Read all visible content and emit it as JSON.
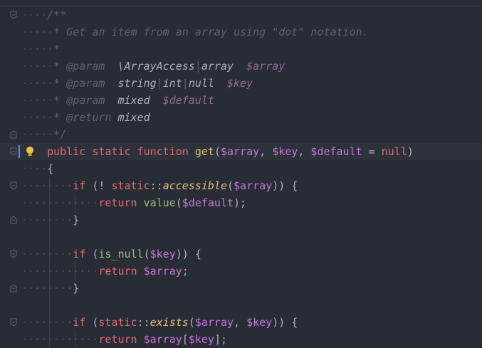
{
  "editor": {
    "lines": [
      {
        "indent": "····",
        "parts": [
          {
            "t": "/**",
            "c": "doc"
          }
        ]
      },
      {
        "indent": "·····",
        "parts": [
          {
            "t": "* Get an item from an array using \"dot\" notation.",
            "c": "doc"
          }
        ]
      },
      {
        "indent": "·····",
        "parts": [
          {
            "t": "*",
            "c": "doc"
          }
        ]
      },
      {
        "indent": "·····",
        "parts": [
          {
            "t": "* ",
            "c": "doc"
          },
          {
            "t": "@param",
            "c": "tag"
          },
          {
            "t": "  ",
            "c": "doc"
          },
          {
            "t": "\\ArrayAccess",
            "c": "type"
          },
          {
            "t": "|",
            "c": "doc"
          },
          {
            "t": "array",
            "c": "type"
          },
          {
            "t": "  ",
            "c": "doc"
          },
          {
            "t": "$array",
            "c": "dvar"
          }
        ]
      },
      {
        "indent": "·····",
        "parts": [
          {
            "t": "* ",
            "c": "doc"
          },
          {
            "t": "@param",
            "c": "tag"
          },
          {
            "t": "  ",
            "c": "doc"
          },
          {
            "t": "string",
            "c": "type"
          },
          {
            "t": "|",
            "c": "doc"
          },
          {
            "t": "int",
            "c": "type"
          },
          {
            "t": "|",
            "c": "doc"
          },
          {
            "t": "null",
            "c": "type"
          },
          {
            "t": "  ",
            "c": "doc"
          },
          {
            "t": "$key",
            "c": "dvar"
          }
        ]
      },
      {
        "indent": "·····",
        "parts": [
          {
            "t": "* ",
            "c": "doc"
          },
          {
            "t": "@param",
            "c": "tag"
          },
          {
            "t": "  ",
            "c": "doc"
          },
          {
            "t": "mixed",
            "c": "type"
          },
          {
            "t": "  ",
            "c": "doc"
          },
          {
            "t": "$default",
            "c": "dvar"
          }
        ]
      },
      {
        "indent": "·····",
        "parts": [
          {
            "t": "* ",
            "c": "doc"
          },
          {
            "t": "@return",
            "c": "tag"
          },
          {
            "t": " ",
            "c": "doc"
          },
          {
            "t": "mixed",
            "c": "type"
          }
        ]
      },
      {
        "indent": "·····",
        "parts": [
          {
            "t": "*/",
            "c": "doc"
          }
        ]
      },
      {
        "indent": "    ",
        "parts": [
          {
            "t": "public",
            "c": "kw"
          },
          {
            "t": " ",
            "c": "pun"
          },
          {
            "t": "static",
            "c": "kw"
          },
          {
            "t": " ",
            "c": "pun"
          },
          {
            "t": "function",
            "c": "kw"
          },
          {
            "t": " ",
            "c": "pun"
          },
          {
            "t": "get",
            "c": "fn"
          },
          {
            "t": "(",
            "c": "pun"
          },
          {
            "t": "$array",
            "c": "var"
          },
          {
            "t": ", ",
            "c": "pun"
          },
          {
            "t": "$key",
            "c": "var"
          },
          {
            "t": ", ",
            "c": "pun"
          },
          {
            "t": "$default",
            "c": "var"
          },
          {
            "t": " = ",
            "c": "pun"
          },
          {
            "t": "null",
            "c": "lit"
          },
          {
            "t": ")",
            "c": "pun"
          }
        ]
      },
      {
        "indent": "····",
        "parts": [
          {
            "t": "{",
            "c": "pun"
          }
        ]
      },
      {
        "indent": "········",
        "parts": [
          {
            "t": "if",
            "c": "kw"
          },
          {
            "t": " (! ",
            "c": "pun"
          },
          {
            "t": "static",
            "c": "kw"
          },
          {
            "t": "::",
            "c": "pun"
          },
          {
            "t": "accessible",
            "c": "fn-i"
          },
          {
            "t": "(",
            "c": "pun"
          },
          {
            "t": "$array",
            "c": "var"
          },
          {
            "t": ")) {",
            "c": "pun"
          }
        ]
      },
      {
        "indent": "············",
        "parts": [
          {
            "t": "return",
            "c": "kw"
          },
          {
            "t": " ",
            "c": "pun"
          },
          {
            "t": "value",
            "c": "call"
          },
          {
            "t": "(",
            "c": "pun"
          },
          {
            "t": "$default",
            "c": "var"
          },
          {
            "t": ");",
            "c": "pun"
          }
        ]
      },
      {
        "indent": "········",
        "parts": [
          {
            "t": "}",
            "c": "pun"
          }
        ]
      },
      {
        "indent": "",
        "parts": []
      },
      {
        "indent": "········",
        "parts": [
          {
            "t": "if",
            "c": "kw"
          },
          {
            "t": " (",
            "c": "pun"
          },
          {
            "t": "is_null",
            "c": "call"
          },
          {
            "t": "(",
            "c": "pun"
          },
          {
            "t": "$key",
            "c": "var"
          },
          {
            "t": ")) {",
            "c": "pun"
          }
        ]
      },
      {
        "indent": "············",
        "parts": [
          {
            "t": "return",
            "c": "kw"
          },
          {
            "t": " ",
            "c": "pun"
          },
          {
            "t": "$array",
            "c": "var"
          },
          {
            "t": ";",
            "c": "pun"
          }
        ]
      },
      {
        "indent": "········",
        "parts": [
          {
            "t": "}",
            "c": "pun"
          }
        ]
      },
      {
        "indent": "",
        "parts": []
      },
      {
        "indent": "········",
        "parts": [
          {
            "t": "if",
            "c": "kw"
          },
          {
            "t": " (",
            "c": "pun"
          },
          {
            "t": "static",
            "c": "kw"
          },
          {
            "t": "::",
            "c": "pun"
          },
          {
            "t": "exists",
            "c": "fn-i"
          },
          {
            "t": "(",
            "c": "pun"
          },
          {
            "t": "$array",
            "c": "var"
          },
          {
            "t": ", ",
            "c": "pun"
          },
          {
            "t": "$key",
            "c": "var"
          },
          {
            "t": ")) {",
            "c": "pun"
          }
        ]
      },
      {
        "indent": "············",
        "parts": [
          {
            "t": "return",
            "c": "kw"
          },
          {
            "t": " ",
            "c": "pun"
          },
          {
            "t": "$array",
            "c": "var"
          },
          {
            "t": "[",
            "c": "pun"
          },
          {
            "t": "$key",
            "c": "var"
          },
          {
            "t": "];",
            "c": "pun"
          }
        ]
      }
    ]
  },
  "colors": {
    "background": "#282c34",
    "active_line": "#2c313a",
    "keyword": "#e06c75",
    "function": "#e5c07b",
    "variable": "#c678dd",
    "doc_comment": "#5c6370"
  },
  "icons": {
    "fold_marker": "fold-icon",
    "intention": "lightbulb-icon"
  }
}
